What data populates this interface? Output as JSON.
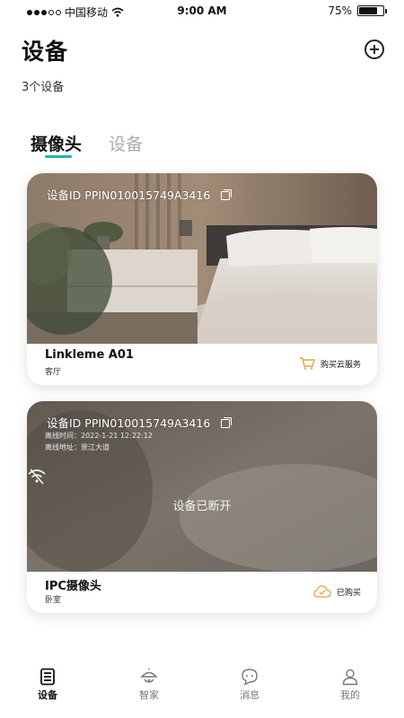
{
  "status_bar": {
    "carrier": "中国移动",
    "time": "9:00 AM",
    "battery": "75%",
    "battery_level": 0.75,
    "wifi_icon": "wifi-icon"
  },
  "header": {
    "title": "设备",
    "add_icon": "plus-circle-icon",
    "device_count": "3个设备"
  },
  "tabs": [
    {
      "label": "摄像头",
      "active": true
    },
    {
      "label": "设备",
      "active": false
    }
  ],
  "devices": [
    {
      "device_id": "设备ID PPIN010015749A3416",
      "name": "Linkleme A01",
      "room": "客厅",
      "service_label": "购买云服务",
      "service_icon": "cart-icon",
      "status": "online"
    },
    {
      "device_id": "设备ID PPIN010015749A3416",
      "offline_time": "离线时间：2022-1-21 12:22:12",
      "offline_address": "离线地址：景江大道",
      "disconnected_text": "设备已断开",
      "name": "IPC摄像头",
      "room": "卧室",
      "service_label": "已购买",
      "service_icon": "cloud-check-icon",
      "status": "offline"
    }
  ],
  "bottom_nav": [
    {
      "label": "设备",
      "icon": "device-list-icon",
      "active": true
    },
    {
      "label": "智家",
      "icon": "smart-home-icon",
      "active": false
    },
    {
      "label": "消息",
      "icon": "message-icon",
      "active": false
    },
    {
      "label": "我的",
      "icon": "profile-icon",
      "active": false
    }
  ],
  "colors": {
    "accent": "#25b3a6",
    "service_icon": "#e0a24a"
  }
}
